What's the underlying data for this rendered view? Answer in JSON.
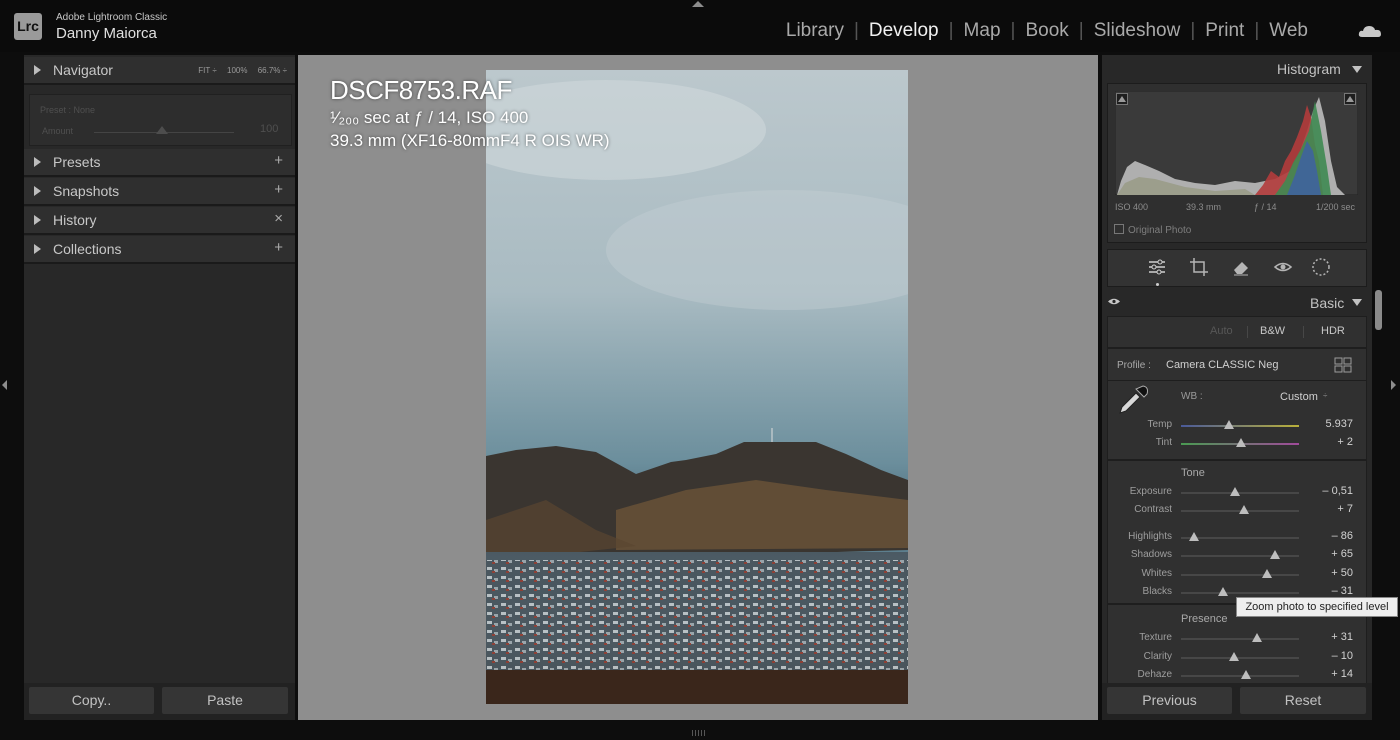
{
  "app": {
    "logo": "Lrc",
    "name": "Adobe Lightroom Classic",
    "user": "Danny Maiorca"
  },
  "modules": [
    {
      "label": "Library",
      "active": false
    },
    {
      "label": "Develop",
      "active": true
    },
    {
      "label": "Map",
      "active": false
    },
    {
      "label": "Book",
      "active": false
    },
    {
      "label": "Slideshow",
      "active": false
    },
    {
      "label": "Print",
      "active": false
    },
    {
      "label": "Web",
      "active": false
    }
  ],
  "left_panel": {
    "navigator": {
      "label": "Navigator",
      "zoom_fit": "FIT ÷",
      "zoom_100": "100%",
      "zoom_667": "66.7% ÷"
    },
    "preset": {
      "label": "Preset : None",
      "amount_label": "Amount",
      "amount_value": "100"
    },
    "sections": [
      {
        "label": "Presets",
        "action": "+"
      },
      {
        "label": "Snapshots",
        "action": "+"
      },
      {
        "label": "History",
        "action": "×"
      },
      {
        "label": "Collections",
        "action": "+"
      }
    ],
    "copy_label": "Copy..",
    "paste_label": "Paste"
  },
  "photo_info": {
    "file_name": "DSCF8753.RAF",
    "exposure_line": "¹⁄₂₀₀ sec at ƒ / 14, ISO 400",
    "lens_line": "39.3 mm (XF16-80mmF4 R OIS WR)"
  },
  "histogram": {
    "label": "Histogram",
    "iso": "ISO 400",
    "focal": "39.3 mm",
    "aperture": "ƒ / 14",
    "shutter": "1/200 sec",
    "original_photo": "Original Photo"
  },
  "basic": {
    "label": "Basic",
    "auto": "Auto",
    "bw": "B&W",
    "hdr": "HDR",
    "profile_label": "Profile :",
    "profile_value": "Camera CLASSIC Neg",
    "wb_label": "WB :",
    "wb_value": "Custom",
    "tone_title": "Tone",
    "presence_title": "Presence",
    "sliders": [
      {
        "label": "Temp",
        "value": "5.937",
        "position": 0.41
      },
      {
        "label": "Tint",
        "value": "+ 2",
        "position": 0.51
      },
      {
        "label": "Exposure",
        "value": "– 0,51",
        "position": 0.46
      },
      {
        "label": "Contrast",
        "value": "+ 7",
        "position": 0.53
      },
      {
        "label": "Highlights",
        "value": "– 86",
        "position": 0.11
      },
      {
        "label": "Shadows",
        "value": "+ 65",
        "position": 0.8
      },
      {
        "label": "Whites",
        "value": "+ 50",
        "position": 0.73
      },
      {
        "label": "Blacks",
        "value": "– 31",
        "position": 0.36
      },
      {
        "label": "Texture",
        "value": "+ 31",
        "position": 0.64
      },
      {
        "label": "Clarity",
        "value": "– 10",
        "position": 0.45
      },
      {
        "label": "Dehaze",
        "value": "+ 14",
        "position": 0.55
      }
    ],
    "tooltip": "Zoom photo to specified level",
    "previous_label": "Previous",
    "reset_label": "Reset"
  }
}
